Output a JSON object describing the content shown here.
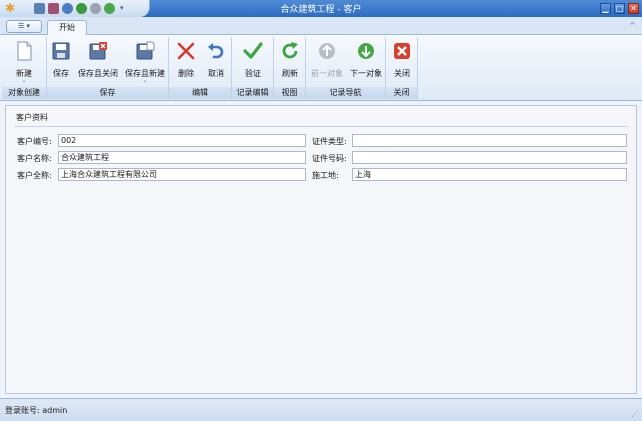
{
  "window": {
    "title": "合众建筑工程 - 客户",
    "minimize_glyph": "▁",
    "maximize_glyph": "□",
    "close_glyph": "✕"
  },
  "tabs": {
    "app_menu_label": "☰ ▾",
    "active_tab": "开始",
    "collapse_glyph": "^"
  },
  "ribbon": {
    "groups": {
      "object_create": "对象创建",
      "save": "保存",
      "edit": "编辑",
      "record_edit": "记录编辑",
      "view": "视图",
      "record_nav": "记录导航",
      "close": "关闭"
    },
    "buttons": {
      "new": "新建",
      "save": "保存",
      "save_close": "保存且关闭",
      "save_new": "保存且新建",
      "delete": "删除",
      "cancel": "取消",
      "validate": "验证",
      "refresh": "刷新",
      "prev": "前一对象",
      "next": "下一对象",
      "close": "关闭"
    },
    "caret_glyph": "⌄"
  },
  "form": {
    "section_title": "客户资料",
    "fields": {
      "customer_no": {
        "label": "客户编号:",
        "value": "002"
      },
      "customer_name": {
        "label": "客户名称:",
        "value": "合众建筑工程"
      },
      "customer_fullname": {
        "label": "客户全称:",
        "value": "上海合众建筑工程有限公司"
      },
      "id_type": {
        "label": "证件类型:",
        "value": ""
      },
      "id_no": {
        "label": "证件号码:",
        "value": ""
      },
      "site": {
        "label": "施工地:",
        "value": "上海"
      }
    }
  },
  "status": {
    "login_text": "登录账号: admin",
    "grip_glyph": "⋰"
  },
  "colors": {
    "title_bar": "#2d6bc0",
    "ribbon_bg": "#dfe9f6",
    "delete_red": "#d23b2b",
    "validate_green": "#3aa640",
    "close_red": "#d6402f"
  }
}
